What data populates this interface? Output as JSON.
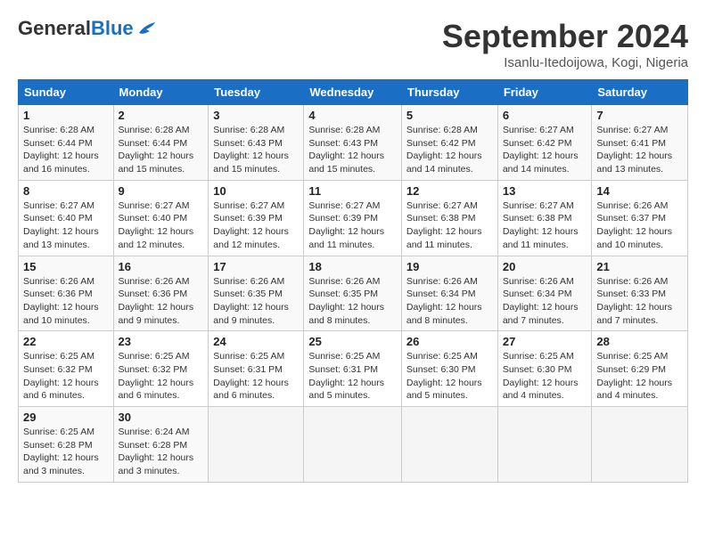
{
  "header": {
    "logo_general": "General",
    "logo_blue": "Blue",
    "title": "September 2024",
    "location": "Isanlu-Itedoijowa, Kogi, Nigeria"
  },
  "calendar": {
    "weekdays": [
      "Sunday",
      "Monday",
      "Tuesday",
      "Wednesday",
      "Thursday",
      "Friday",
      "Saturday"
    ],
    "weeks": [
      [
        {
          "day": "1",
          "sunrise": "6:28 AM",
          "sunset": "6:44 PM",
          "daylight": "12 hours and 16 minutes."
        },
        {
          "day": "2",
          "sunrise": "6:28 AM",
          "sunset": "6:44 PM",
          "daylight": "12 hours and 15 minutes."
        },
        {
          "day": "3",
          "sunrise": "6:28 AM",
          "sunset": "6:43 PM",
          "daylight": "12 hours and 15 minutes."
        },
        {
          "day": "4",
          "sunrise": "6:28 AM",
          "sunset": "6:43 PM",
          "daylight": "12 hours and 15 minutes."
        },
        {
          "day": "5",
          "sunrise": "6:28 AM",
          "sunset": "6:42 PM",
          "daylight": "12 hours and 14 minutes."
        },
        {
          "day": "6",
          "sunrise": "6:27 AM",
          "sunset": "6:42 PM",
          "daylight": "12 hours and 14 minutes."
        },
        {
          "day": "7",
          "sunrise": "6:27 AM",
          "sunset": "6:41 PM",
          "daylight": "12 hours and 13 minutes."
        }
      ],
      [
        {
          "day": "8",
          "sunrise": "6:27 AM",
          "sunset": "6:40 PM",
          "daylight": "12 hours and 13 minutes."
        },
        {
          "day": "9",
          "sunrise": "6:27 AM",
          "sunset": "6:40 PM",
          "daylight": "12 hours and 12 minutes."
        },
        {
          "day": "10",
          "sunrise": "6:27 AM",
          "sunset": "6:39 PM",
          "daylight": "12 hours and 12 minutes."
        },
        {
          "day": "11",
          "sunrise": "6:27 AM",
          "sunset": "6:39 PM",
          "daylight": "12 hours and 11 minutes."
        },
        {
          "day": "12",
          "sunrise": "6:27 AM",
          "sunset": "6:38 PM",
          "daylight": "12 hours and 11 minutes."
        },
        {
          "day": "13",
          "sunrise": "6:27 AM",
          "sunset": "6:38 PM",
          "daylight": "12 hours and 11 minutes."
        },
        {
          "day": "14",
          "sunrise": "6:26 AM",
          "sunset": "6:37 PM",
          "daylight": "12 hours and 10 minutes."
        }
      ],
      [
        {
          "day": "15",
          "sunrise": "6:26 AM",
          "sunset": "6:36 PM",
          "daylight": "12 hours and 10 minutes."
        },
        {
          "day": "16",
          "sunrise": "6:26 AM",
          "sunset": "6:36 PM",
          "daylight": "12 hours and 9 minutes."
        },
        {
          "day": "17",
          "sunrise": "6:26 AM",
          "sunset": "6:35 PM",
          "daylight": "12 hours and 9 minutes."
        },
        {
          "day": "18",
          "sunrise": "6:26 AM",
          "sunset": "6:35 PM",
          "daylight": "12 hours and 8 minutes."
        },
        {
          "day": "19",
          "sunrise": "6:26 AM",
          "sunset": "6:34 PM",
          "daylight": "12 hours and 8 minutes."
        },
        {
          "day": "20",
          "sunrise": "6:26 AM",
          "sunset": "6:34 PM",
          "daylight": "12 hours and 7 minutes."
        },
        {
          "day": "21",
          "sunrise": "6:26 AM",
          "sunset": "6:33 PM",
          "daylight": "12 hours and 7 minutes."
        }
      ],
      [
        {
          "day": "22",
          "sunrise": "6:25 AM",
          "sunset": "6:32 PM",
          "daylight": "12 hours and 6 minutes."
        },
        {
          "day": "23",
          "sunrise": "6:25 AM",
          "sunset": "6:32 PM",
          "daylight": "12 hours and 6 minutes."
        },
        {
          "day": "24",
          "sunrise": "6:25 AM",
          "sunset": "6:31 PM",
          "daylight": "12 hours and 6 minutes."
        },
        {
          "day": "25",
          "sunrise": "6:25 AM",
          "sunset": "6:31 PM",
          "daylight": "12 hours and 5 minutes."
        },
        {
          "day": "26",
          "sunrise": "6:25 AM",
          "sunset": "6:30 PM",
          "daylight": "12 hours and 5 minutes."
        },
        {
          "day": "27",
          "sunrise": "6:25 AM",
          "sunset": "6:30 PM",
          "daylight": "12 hours and 4 minutes."
        },
        {
          "day": "28",
          "sunrise": "6:25 AM",
          "sunset": "6:29 PM",
          "daylight": "12 hours and 4 minutes."
        }
      ],
      [
        {
          "day": "29",
          "sunrise": "6:25 AM",
          "sunset": "6:28 PM",
          "daylight": "12 hours and 3 minutes."
        },
        {
          "day": "30",
          "sunrise": "6:24 AM",
          "sunset": "6:28 PM",
          "daylight": "12 hours and 3 minutes."
        },
        null,
        null,
        null,
        null,
        null
      ]
    ]
  }
}
